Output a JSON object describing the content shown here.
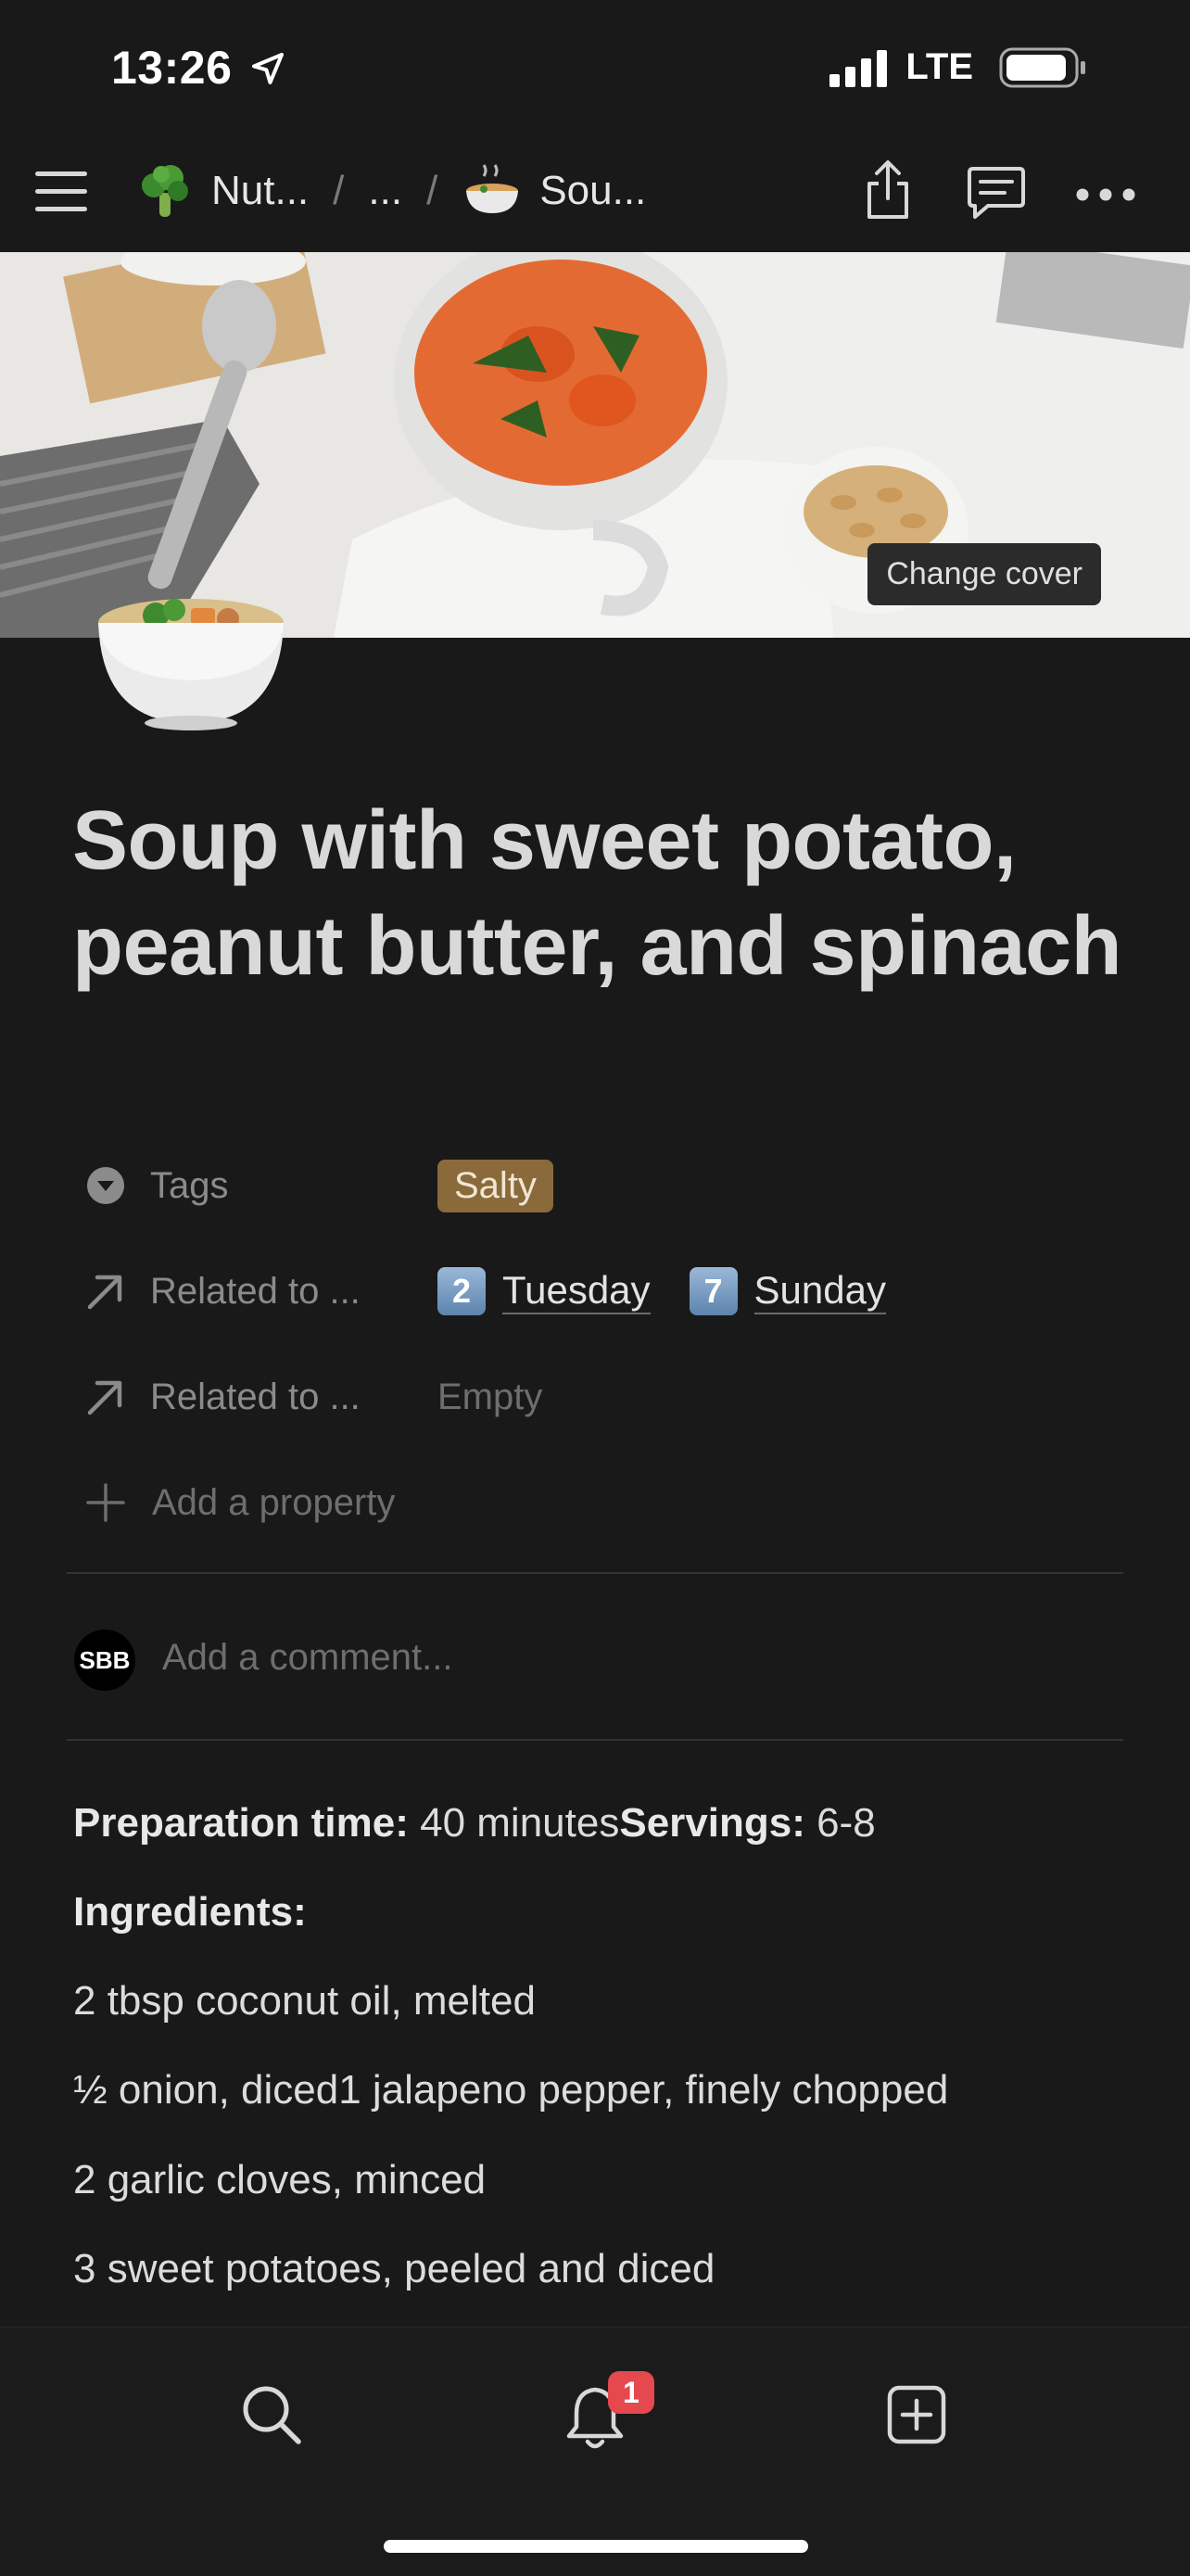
{
  "status_bar": {
    "time": "13:26",
    "network": "LTE"
  },
  "nav": {
    "crumb1": "Nut...",
    "crumb2": "...",
    "crumb3": "Sou...",
    "separator": "/"
  },
  "cover": {
    "change_label": "Change cover"
  },
  "page": {
    "title": "Soup with sweet potato, peanut butter, and spinach"
  },
  "properties": {
    "tags": {
      "label": "Tags",
      "value": "Salty",
      "color": "#8a6a3a"
    },
    "related1": {
      "label": "Related to ...",
      "items": [
        {
          "badge": "2",
          "text": "Tuesday"
        },
        {
          "badge": "7",
          "text": "Sunday"
        }
      ]
    },
    "related2": {
      "label": "Related to ...",
      "value": "Empty"
    },
    "add_property": "Add a property"
  },
  "comment": {
    "avatar": "SBB",
    "placeholder": "Add a comment..."
  },
  "content": {
    "prep_label": "Preparation time:",
    "prep_value": " 40 minutes",
    "servings_label": "Servings:",
    "servings_value": " 6-8",
    "ingredients_label": "Ingredients:",
    "lines": [
      "2 tbsp coconut oil, melted",
      "½ onion, diced1 jalapeno pepper, finely chopped",
      "2 garlic cloves, minced",
      "3 sweet potatoes, peeled and diced"
    ]
  },
  "bottom_bar": {
    "notification_count": "1"
  }
}
